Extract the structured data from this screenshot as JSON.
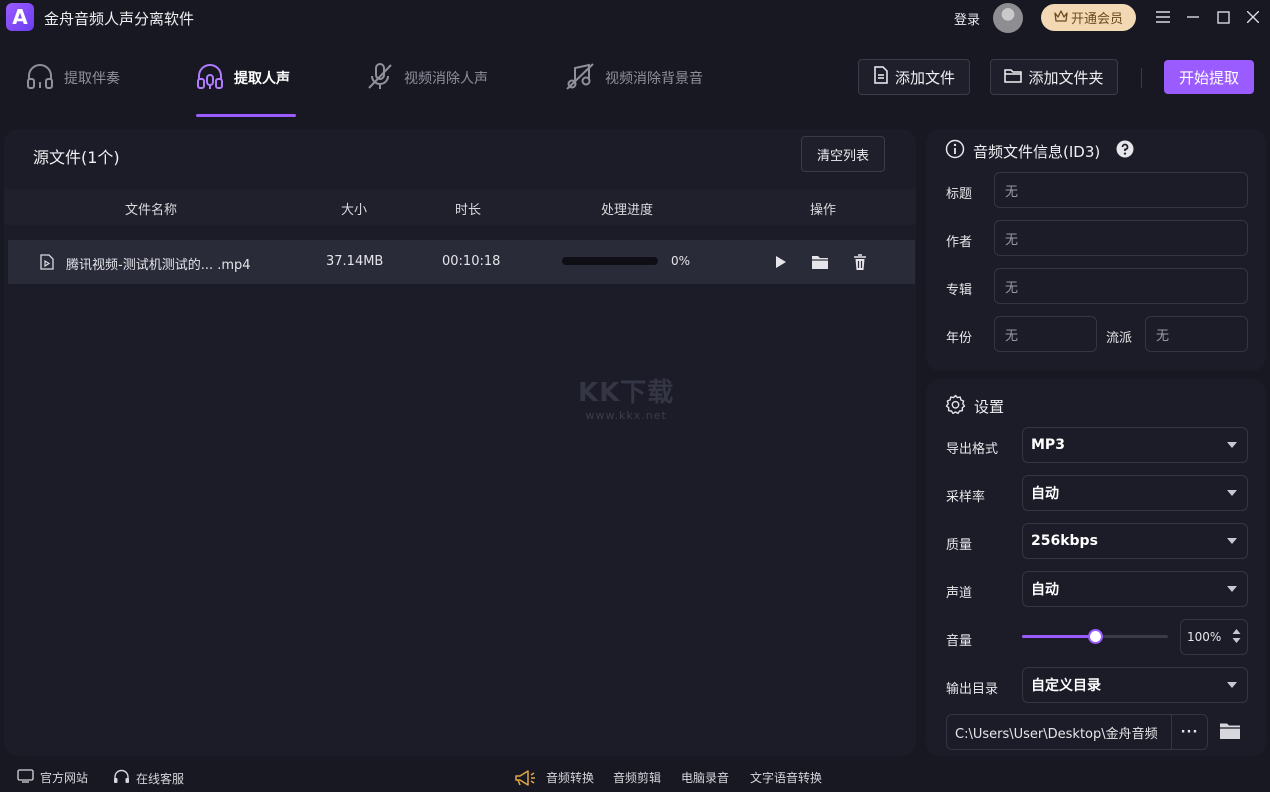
{
  "app": {
    "logo_letter": "A",
    "title": "金舟音频人声分离软件",
    "login_label": "登录",
    "vip_label": "开通会员",
    "accent": "#9b5cff"
  },
  "tabs": [
    {
      "label": "提取伴奏",
      "icon": "headphones-icon",
      "active": false
    },
    {
      "label": "提取人声",
      "icon": "headset-mic-icon",
      "active": true
    },
    {
      "label": "视频消除人声",
      "icon": "mic-off-icon",
      "active": false
    },
    {
      "label": "视频消除背景音",
      "icon": "music-off-icon",
      "active": false
    }
  ],
  "toolbar": {
    "add_file": "添加文件",
    "add_folder": "添加文件夹",
    "start": "开始提取"
  },
  "source": {
    "title": "源文件(1个)",
    "clear_label": "清空列表",
    "columns": [
      "文件名称",
      "大小",
      "时长",
      "处理进度",
      "操作"
    ],
    "files": [
      {
        "name": "腾讯视频-测试机测试的... .mp4",
        "size": "37.14MB",
        "duration": "00:10:18",
        "progress": 0,
        "progress_label": "0%"
      }
    ]
  },
  "watermark": {
    "line1": "KK下载",
    "line2": "www.kkx.net"
  },
  "info": {
    "title": "音频文件信息(ID3)",
    "fields": {
      "title": {
        "label": "标题",
        "value": "无"
      },
      "author": {
        "label": "作者",
        "value": "无"
      },
      "album": {
        "label": "专辑",
        "value": "无"
      },
      "year": {
        "label": "年份",
        "value": "无"
      },
      "genre": {
        "label": "流派",
        "value": "无"
      }
    }
  },
  "settings": {
    "title": "设置",
    "format": {
      "label": "导出格式",
      "value": "MP3"
    },
    "sample_rate": {
      "label": "采样率",
      "value": "自动"
    },
    "quality": {
      "label": "质量",
      "value": "256kbps"
    },
    "channel": {
      "label": "声道",
      "value": "自动"
    },
    "volume": {
      "label": "音量",
      "value": "100%",
      "level": 0.5
    },
    "output": {
      "label": "输出目录",
      "value": "自定义目录"
    },
    "path": "C:\\Users\\User\\Desktop\\金舟音频",
    "path_more": "···"
  },
  "footer": {
    "website": "官方网站",
    "support": "在线客服",
    "links": [
      "音频转换",
      "音频剪辑",
      "电脑录音",
      "文字语音转换"
    ]
  }
}
